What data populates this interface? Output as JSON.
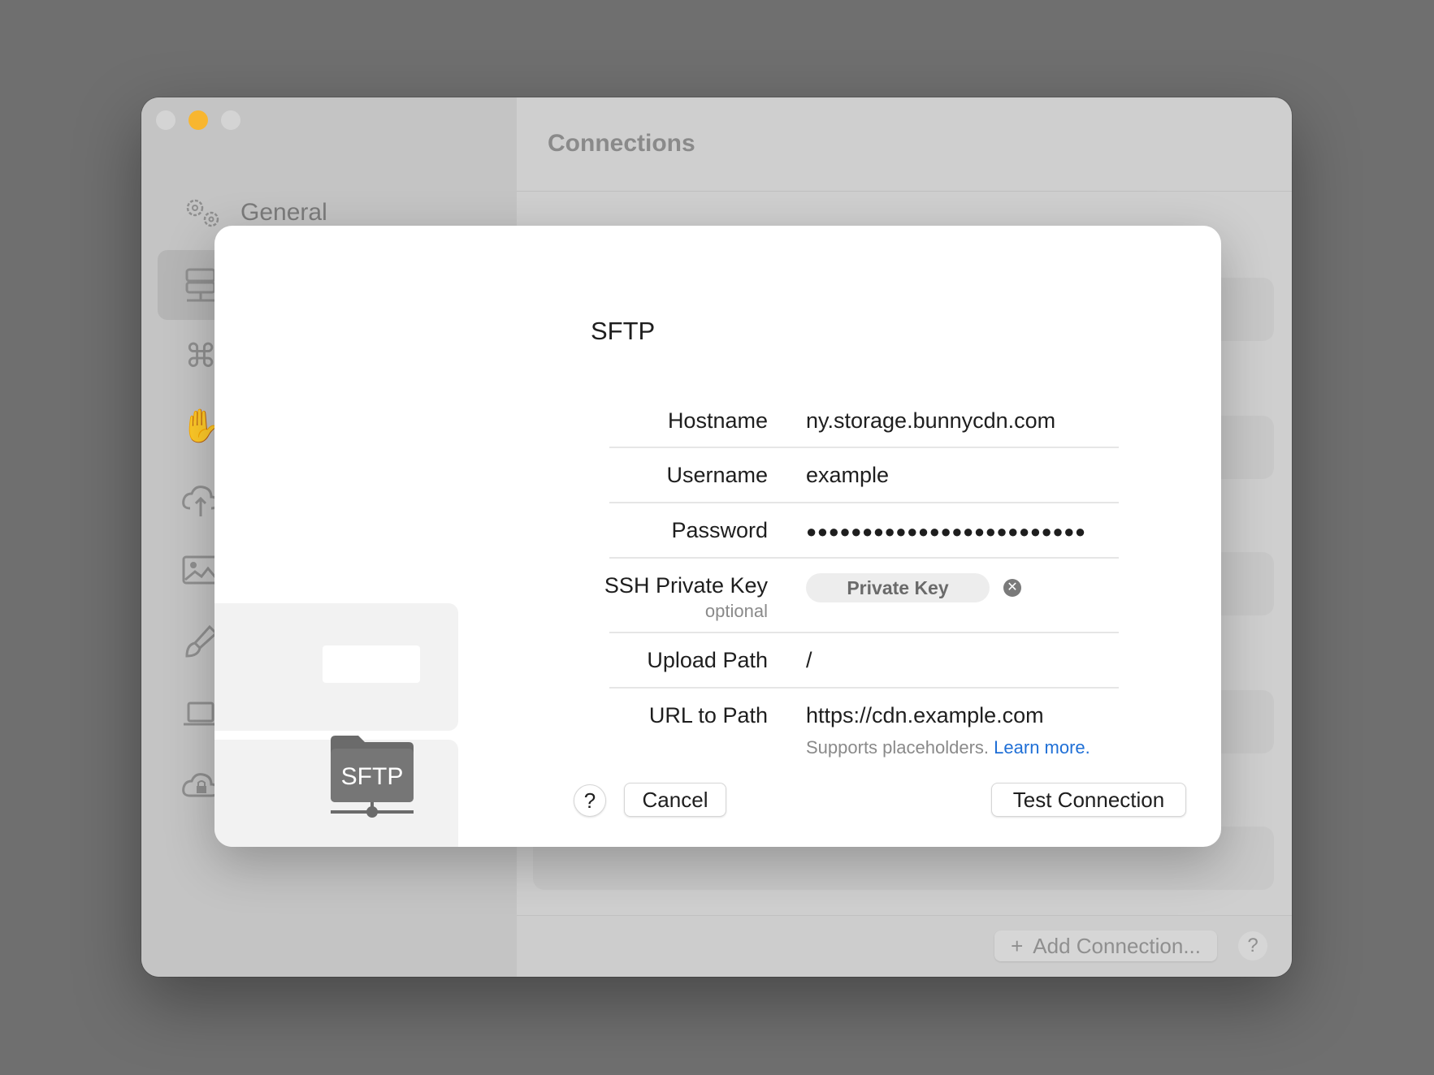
{
  "window": {
    "sidebar": {
      "general_label": "General"
    },
    "content": {
      "title": "Connections",
      "add_connection_label": "Add Connection...",
      "help_label": "?"
    }
  },
  "dialog": {
    "title": "SFTP",
    "logo_text": "SFTP",
    "fields": {
      "hostname_label": "Hostname",
      "hostname_value": "ny.storage.bunnycdn.com",
      "username_label": "Username",
      "username_value": "example",
      "password_label": "Password",
      "password_value": "●●●●●●●●●●●●●●●●●●●●●●●●●",
      "ssh_key_label": "SSH Private Key",
      "ssh_key_sublabel": "optional",
      "ssh_key_button": "Private Key",
      "upload_path_label": "Upload Path",
      "upload_path_value": "/",
      "url_label": "URL to Path",
      "url_value": "https://cdn.example.com",
      "url_hint": "Supports placeholders.",
      "url_hint_link": "Learn more."
    },
    "buttons": {
      "help": "?",
      "cancel": "Cancel",
      "test_connection": "Test Connection"
    }
  },
  "colors": {
    "accent_link": "#1f6fd6",
    "traffic_minimize": "#f8b630"
  }
}
